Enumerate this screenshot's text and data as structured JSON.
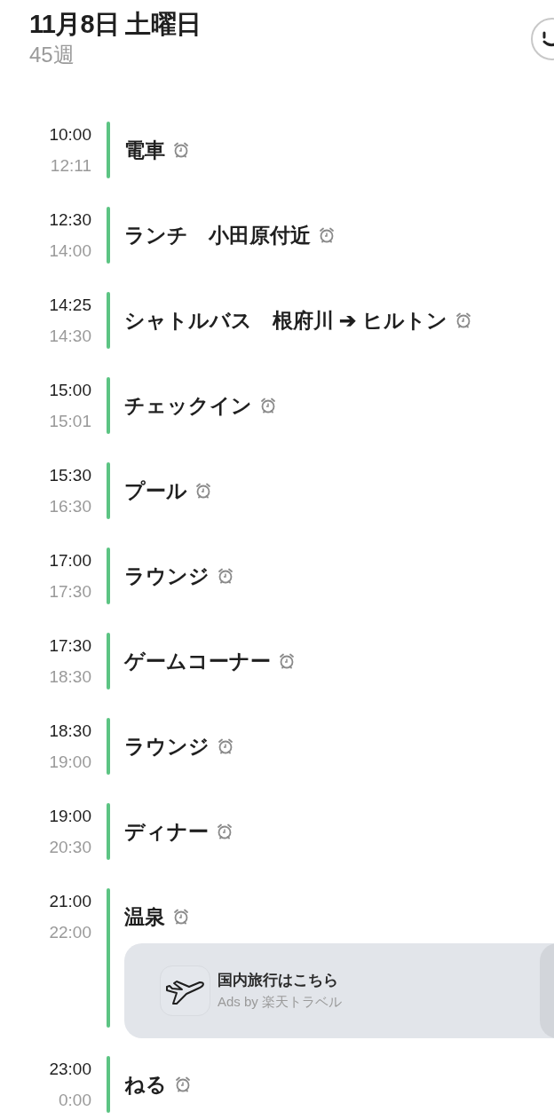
{
  "header": {
    "date": "11月8日 土曜日",
    "week": "45週"
  },
  "events": [
    {
      "start": "10:00",
      "end": "12:11",
      "title": "電車",
      "alarm": true
    },
    {
      "start": "12:30",
      "end": "14:00",
      "title": "ランチ　小田原付近",
      "alarm": true
    },
    {
      "start": "14:25",
      "end": "14:30",
      "title": "シャトルバス　根府川 ➔ ヒルトン",
      "alarm": true
    },
    {
      "start": "15:00",
      "end": "15:01",
      "title": "チェックイン",
      "alarm": true
    },
    {
      "start": "15:30",
      "end": "16:30",
      "title": "プール",
      "alarm": true
    },
    {
      "start": "17:00",
      "end": "17:30",
      "title": "ラウンジ",
      "alarm": true
    },
    {
      "start": "17:30",
      "end": "18:30",
      "title": "ゲームコーナー",
      "alarm": true
    },
    {
      "start": "18:30",
      "end": "19:00",
      "title": "ラウンジ",
      "alarm": true
    },
    {
      "start": "19:00",
      "end": "20:30",
      "title": "ディナー",
      "alarm": true
    },
    {
      "start": "21:00",
      "end": "22:00",
      "title": "温泉",
      "alarm": true,
      "ad": {
        "title": "国内旅行はこちら",
        "source": "Ads by 楽天トラベル"
      }
    },
    {
      "start": "23:00",
      "end": "0:00",
      "title": "ねる",
      "alarm": true
    }
  ]
}
